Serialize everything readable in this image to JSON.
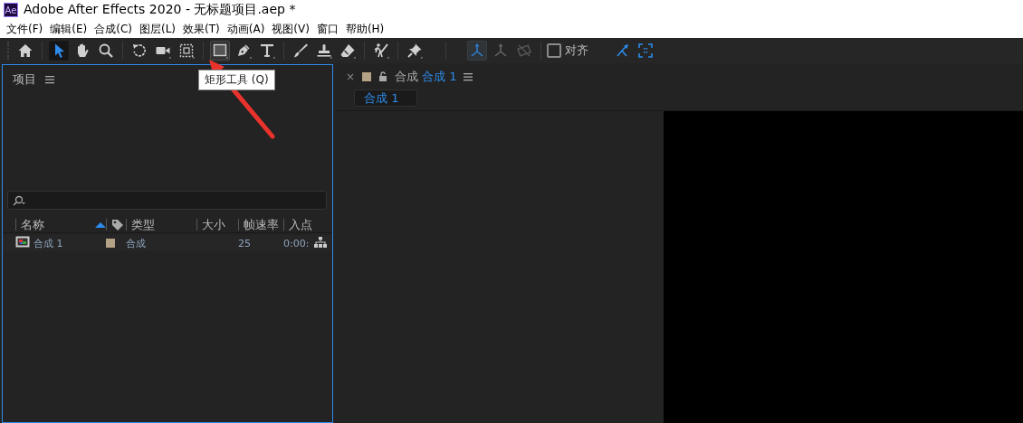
{
  "window": {
    "app_icon": "Ae",
    "title": "Adobe After Effects 2020 - 无标题项目.aep *"
  },
  "menu": [
    "文件(F)",
    "编辑(E)",
    "合成(C)",
    "图层(L)",
    "效果(T)",
    "动画(A)",
    "视图(V)",
    "窗口",
    "帮助(H)"
  ],
  "toolbar": {
    "tools": [
      {
        "selected": false,
        "hovered": false
      },
      {
        "selected": true,
        "hovered": false
      },
      {
        "selected": false,
        "hovered": false
      },
      {
        "selected": false,
        "hovered": false
      },
      {
        "selected": false,
        "hovered": false
      },
      {
        "selected": false,
        "hovered": false
      },
      {
        "selected": false,
        "hovered": false
      },
      {
        "selected": false,
        "hovered": true
      },
      {
        "selected": false,
        "hovered": false
      },
      {
        "selected": false,
        "hovered": false
      },
      {
        "selected": false,
        "hovered": false
      },
      {
        "selected": false,
        "hovered": false
      },
      {
        "selected": false,
        "hovered": false
      },
      {
        "selected": false,
        "hovered": false
      },
      {
        "selected": false,
        "hovered": false
      }
    ],
    "axis_modes": [
      {
        "selected": true
      },
      {
        "selected": false
      },
      {
        "selected": false
      }
    ],
    "snapping": {
      "label": "对齐",
      "checked": false
    }
  },
  "tooltip": "矩形工具 (Q)",
  "project_panel": {
    "title": "项目",
    "columns": [
      {
        "kind": "text",
        "label": "名称",
        "sorted": true
      },
      {
        "kind": "label-icon"
      },
      {
        "kind": "text",
        "label": "类型",
        "sorted": false
      },
      {
        "kind": "text",
        "label": "大小",
        "sorted": false
      },
      {
        "kind": "text",
        "label": "帧速率",
        "sorted": false
      },
      {
        "kind": "text",
        "label": "入点",
        "sorted": false
      }
    ],
    "rows": [
      {
        "name": "合成 1",
        "color": "#b3a285",
        "type": "合成",
        "frame_rate": "25",
        "in_point": "0:00:"
      }
    ]
  },
  "comp_panel": {
    "close": "×",
    "title": "合成",
    "comp_name": "合成 1",
    "tabs": [
      {
        "label": "合成 1",
        "selected": true
      }
    ]
  }
}
